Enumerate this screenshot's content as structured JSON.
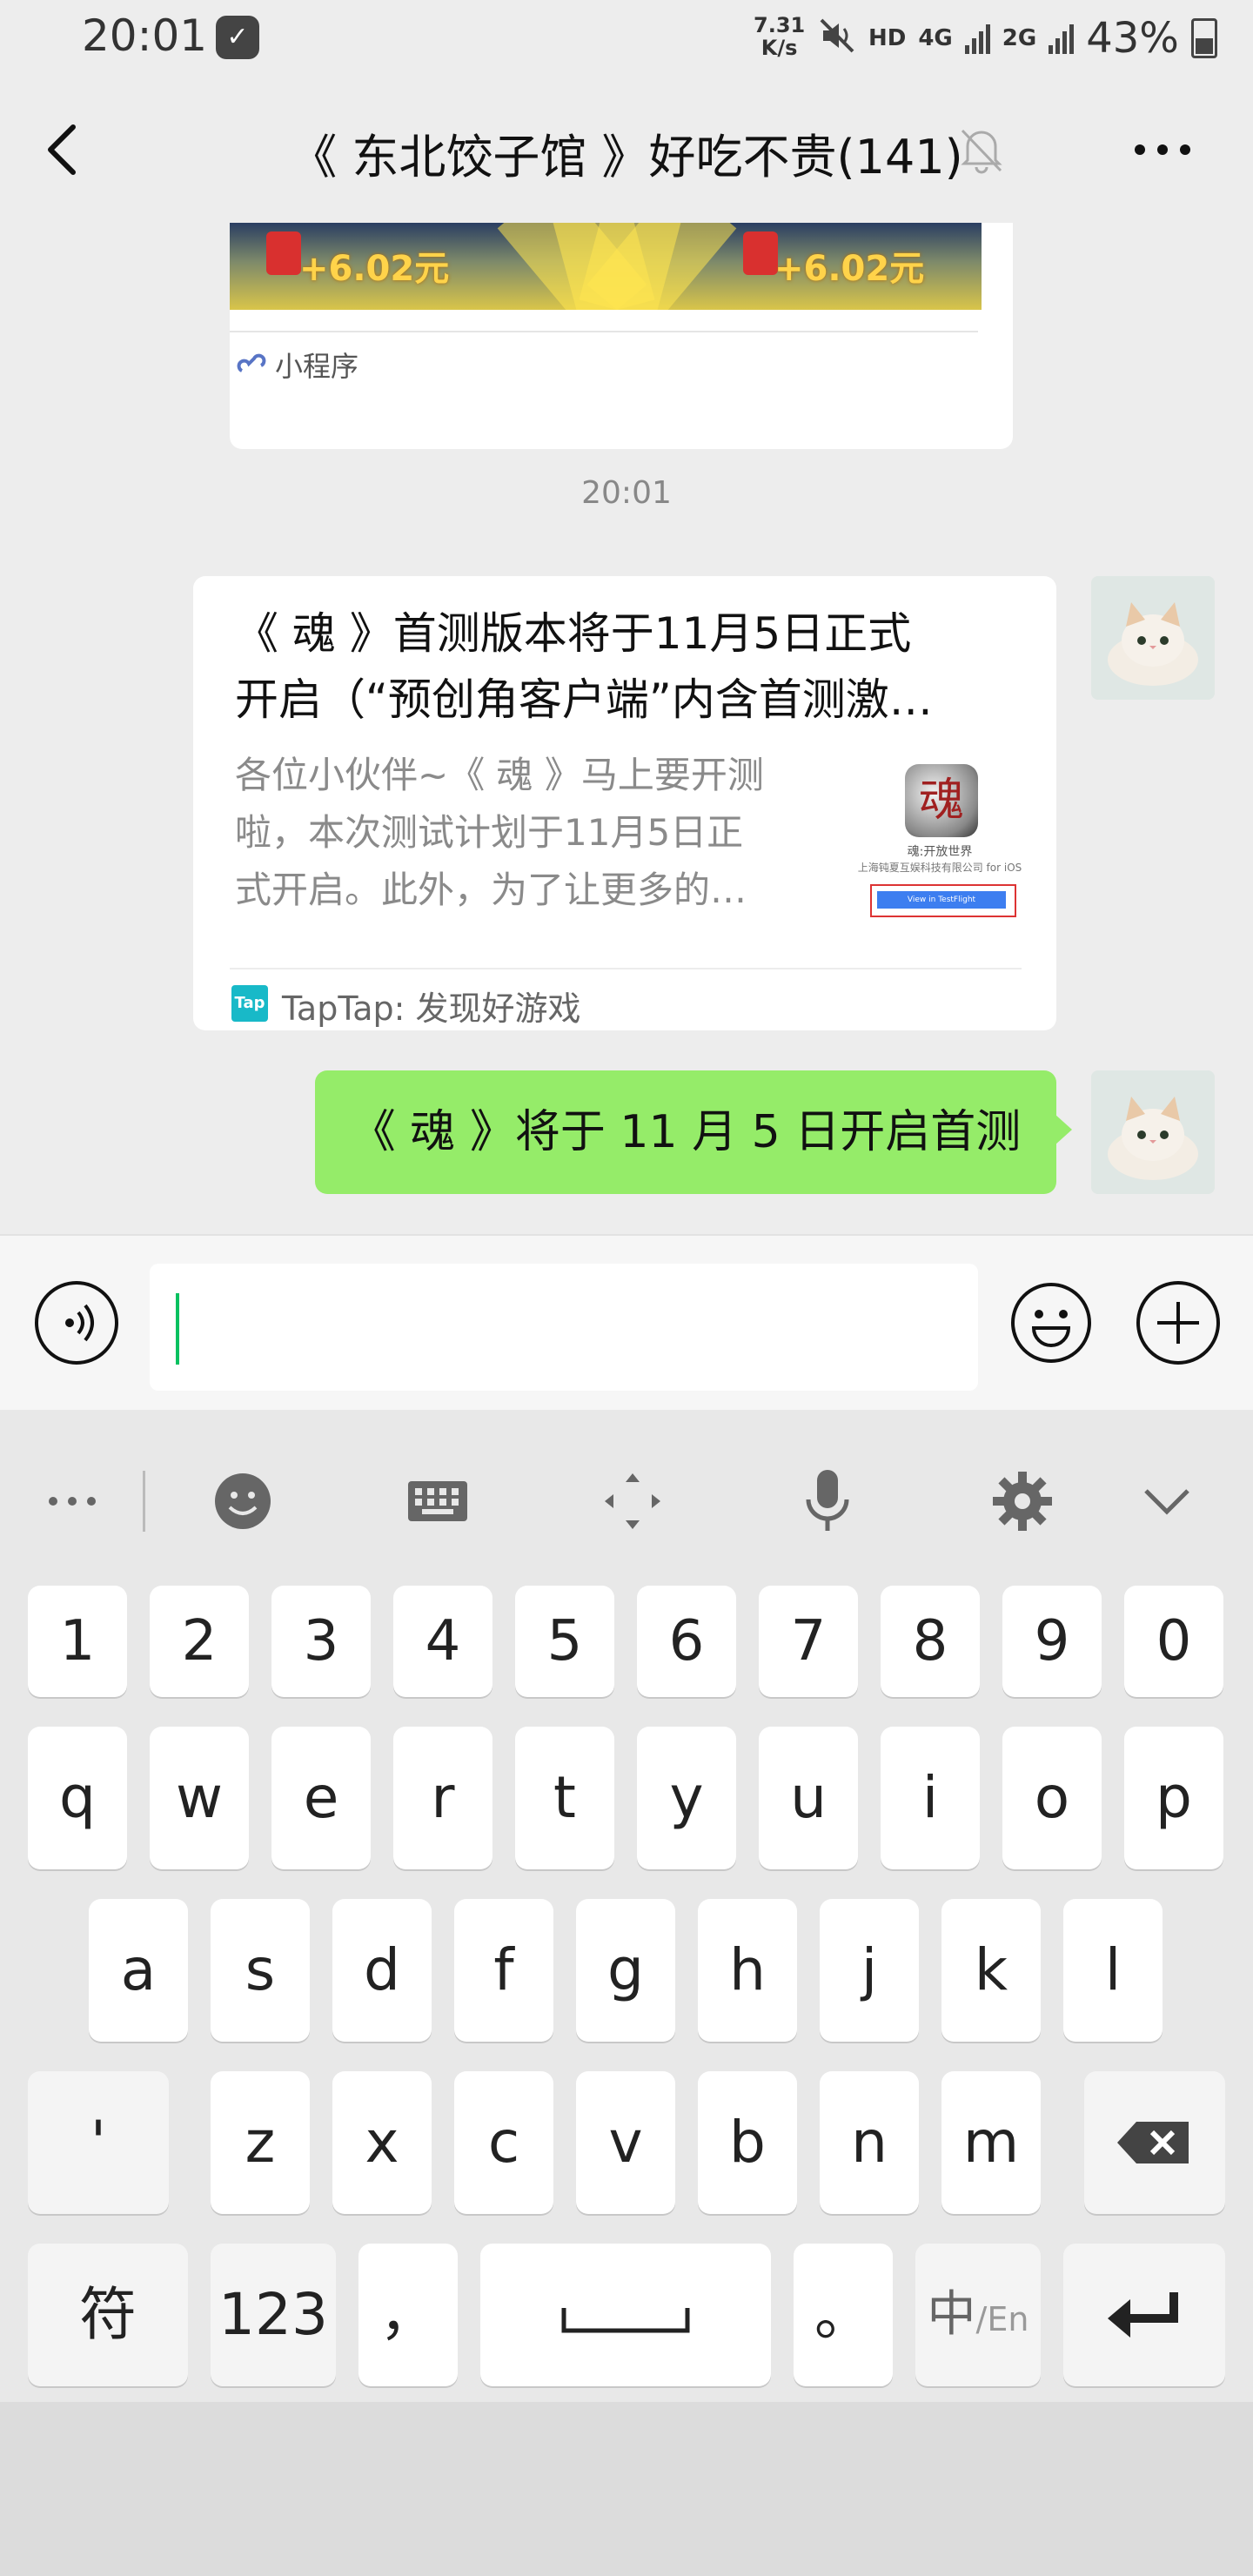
{
  "status_bar": {
    "time": "20:01",
    "network_speed_value": "7.31",
    "network_speed_unit": "K/s",
    "hd": "HD",
    "net_4g": "4G",
    "net_2g": "2G",
    "battery": "43%"
  },
  "header": {
    "title": "《 东北饺子馆 》好吃不贵(141)"
  },
  "messages": {
    "mini_program": {
      "banner_left": "+6.02元",
      "banner_right": "+6.02元",
      "label": "小程序"
    },
    "timestamp": "20:01",
    "link_card": {
      "title_line1": "《 魂 》首测版本将于11月5日正式",
      "title_line2": "开启（“预创角客户端”内含首测激…",
      "desc_line1": "各位小伙伴~《 魂 》马上要开测",
      "desc_line2": "啦，本次测试计划于11月5日正",
      "desc_line3": "式开启。此外，为了让更多的…",
      "thumb_icon_char": "魂",
      "thumb_game_name": "魂:开放世界",
      "thumb_company": "上海钝夏互娱科技有限公司 for iOS",
      "thumb_button": "View in TestFlight",
      "source": "TapTap: 发现好游戏",
      "source_icon": "Tap"
    },
    "sent_text": "《 魂 》将于 11 月 5 日开启首测"
  },
  "keyboard": {
    "numbers": [
      "1",
      "2",
      "3",
      "4",
      "5",
      "6",
      "7",
      "8",
      "9",
      "0"
    ],
    "row1": [
      "q",
      "w",
      "e",
      "r",
      "t",
      "y",
      "u",
      "i",
      "o",
      "p"
    ],
    "row2": [
      "a",
      "s",
      "d",
      "f",
      "g",
      "h",
      "j",
      "k",
      "l"
    ],
    "row3": [
      "z",
      "x",
      "c",
      "v",
      "b",
      "n",
      "m"
    ],
    "apostrophe": "'",
    "symbols_key": "符",
    "numeric_key": "123",
    "comma_key": "，",
    "period_key": "。",
    "lang_key_main": "中",
    "lang_key_sub": "/En"
  },
  "colors": {
    "accent_green": "#95ec69",
    "caret": "#07c160",
    "background": "#ededed"
  }
}
